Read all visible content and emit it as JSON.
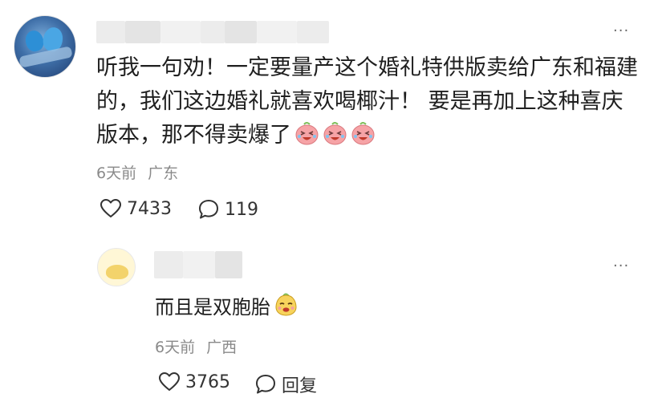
{
  "comment": {
    "text": "听我一句劝！一定要量产这个婚礼特供版卖给广东和福建的，我们这边婚礼就喜欢喝椰汁！ 要是再加上这种喜庆版本，那不得卖爆了",
    "time": "6天前",
    "location": "广东",
    "like_count": "7433",
    "reply_count": "119",
    "emojis": [
      "laugh-cry-emoji",
      "laugh-cry-emoji",
      "laugh-cry-emoji"
    ]
  },
  "reply": {
    "text": "而且是双胞胎",
    "time": "6天前",
    "location": "广西",
    "like_count": "3765",
    "reply_label": "回复",
    "emojis": [
      "smirk-emoji"
    ]
  },
  "more_menu": {
    "label": "···"
  },
  "colors": {
    "text": "#1f1f1f",
    "meta": "#8a8a8a",
    "emoji_pink": "#f6a3a6"
  },
  "icons": {
    "like": "heart-outline-icon",
    "comment": "speech-bubble-icon",
    "more": "more-dots-icon"
  }
}
